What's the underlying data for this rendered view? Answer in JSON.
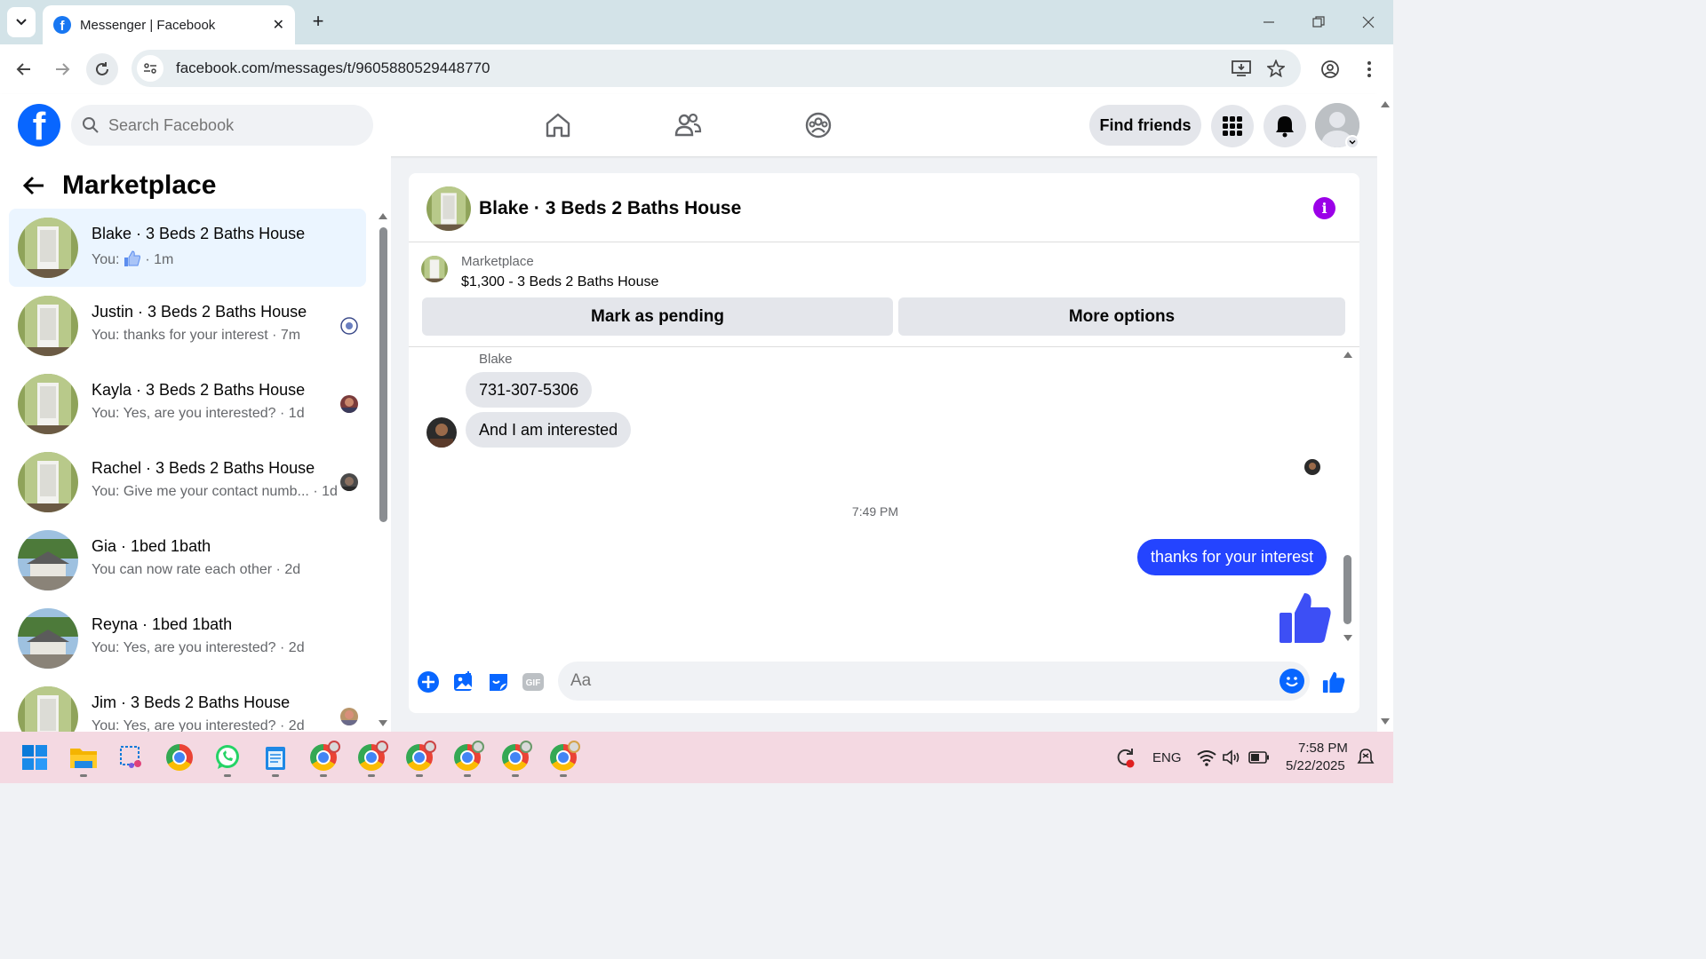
{
  "browser": {
    "tab_title": "Messenger | Facebook",
    "url": "facebook.com/messages/t/9605880529448770"
  },
  "fb_header": {
    "search_placeholder": "Search Facebook",
    "find_friends": "Find friends"
  },
  "left_panel": {
    "title": "Marketplace",
    "conversations": [
      {
        "name": "Blake · 3 Beds 2 Baths House",
        "sub_prefix": "You: ",
        "sub": "· 1m",
        "active": true
      },
      {
        "name": "Justin · 3 Beds 2 Baths House",
        "sub": "You: thanks for your interest · 7m"
      },
      {
        "name": "Kayla · 3 Beds 2 Baths House",
        "sub": "You: Yes, are you interested? · 1d"
      },
      {
        "name": "Rachel · 3 Beds 2 Baths House",
        "sub": "You: Give me your contact numb... · 1d"
      },
      {
        "name": "Gia · 1bed 1bath",
        "sub": "You can now rate each other · 2d"
      },
      {
        "name": "Reyna · 1bed 1bath",
        "sub": "You: Yes, are you interested? · 2d"
      },
      {
        "name": "Jim · 3 Beds 2 Baths House",
        "sub": "You: Yes, are you interested? · 2d"
      }
    ]
  },
  "chat": {
    "title": "Blake · 3 Beds 2 Baths House",
    "marketplace_label": "Marketplace",
    "listing": "$1,300 - 3 Beds 2 Baths House",
    "mark_pending": "Mark as pending",
    "more_options": "More options",
    "sender_name": "Blake",
    "incoming": [
      "731-307-5306",
      "And I am interested"
    ],
    "timestamp": "7:49 PM",
    "outgoing": "thanks for your interest",
    "composer_placeholder": "Aa"
  },
  "taskbar": {
    "language": "ENG",
    "time": "7:58 PM",
    "date": "5/22/2025"
  },
  "colors": {
    "fb_blue": "#0866ff",
    "outgoing_bubble": "#2444ff",
    "active_row": "#ebf5ff",
    "info_purple": "#9b00e8"
  }
}
